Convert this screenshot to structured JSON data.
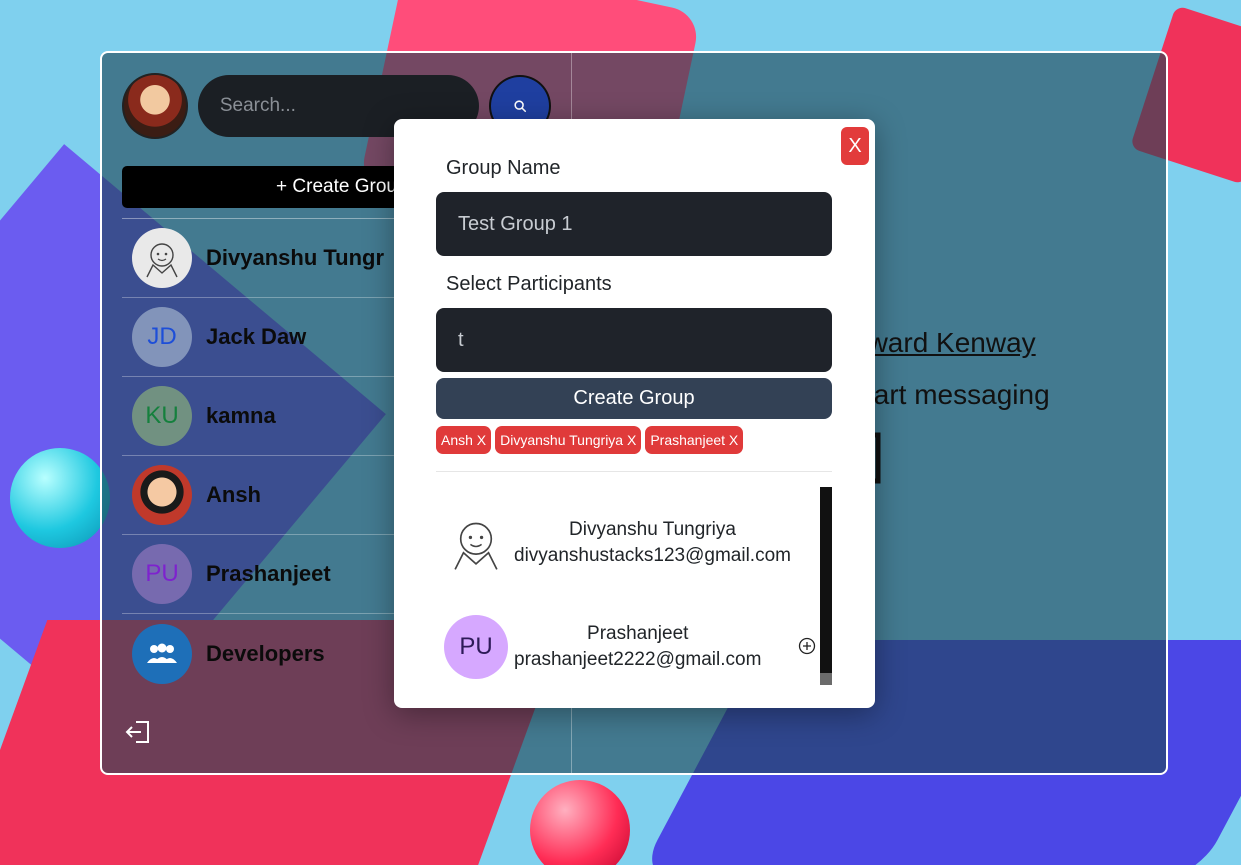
{
  "sidebar": {
    "search_placeholder": "Search...",
    "create_group_label": "+ Create Grou",
    "chats": [
      {
        "initials": "",
        "name": "Divyanshu Tungr",
        "avatar": "sketch-image"
      },
      {
        "initials": "JD",
        "name": "Jack Daw",
        "avatar_color": "#1d4ed8"
      },
      {
        "initials": "KU",
        "name": "kamna",
        "avatar_color": "#15803d"
      },
      {
        "initials": "",
        "name": "Ansh",
        "avatar": "anime-image"
      },
      {
        "initials": "PU",
        "name": "Prashanjeet",
        "avatar_color": "#7e22ce"
      },
      {
        "initials": "",
        "name": "Developers",
        "avatar": "group-icon"
      }
    ]
  },
  "main": {
    "welcome_name": "dward Kenway",
    "welcome_msg": "start messaging"
  },
  "modal": {
    "close_label": "X",
    "group_name_label": "Group Name",
    "group_name_value": "Test Group 1",
    "participants_label": "Select Participants",
    "participants_value": "t",
    "create_button": "Create Group",
    "selected_tags": [
      "Ansh X",
      "Divyanshu Tungriya X",
      "Prashanjeet X"
    ],
    "results": [
      {
        "name": "Divyanshu Tungriya",
        "email": "divyanshustacks123@gmail.com",
        "avatar": "sketch-image"
      },
      {
        "name": "Prashanjeet",
        "initials": "PU",
        "email": "prashanjeet2222@gmail.com"
      }
    ]
  },
  "colors": {
    "close_button": "#e23b3b",
    "tag": "#e03a3a",
    "create_button": "#334155",
    "input_bg": "#1f232a",
    "search_button": "#1f3fa0"
  }
}
